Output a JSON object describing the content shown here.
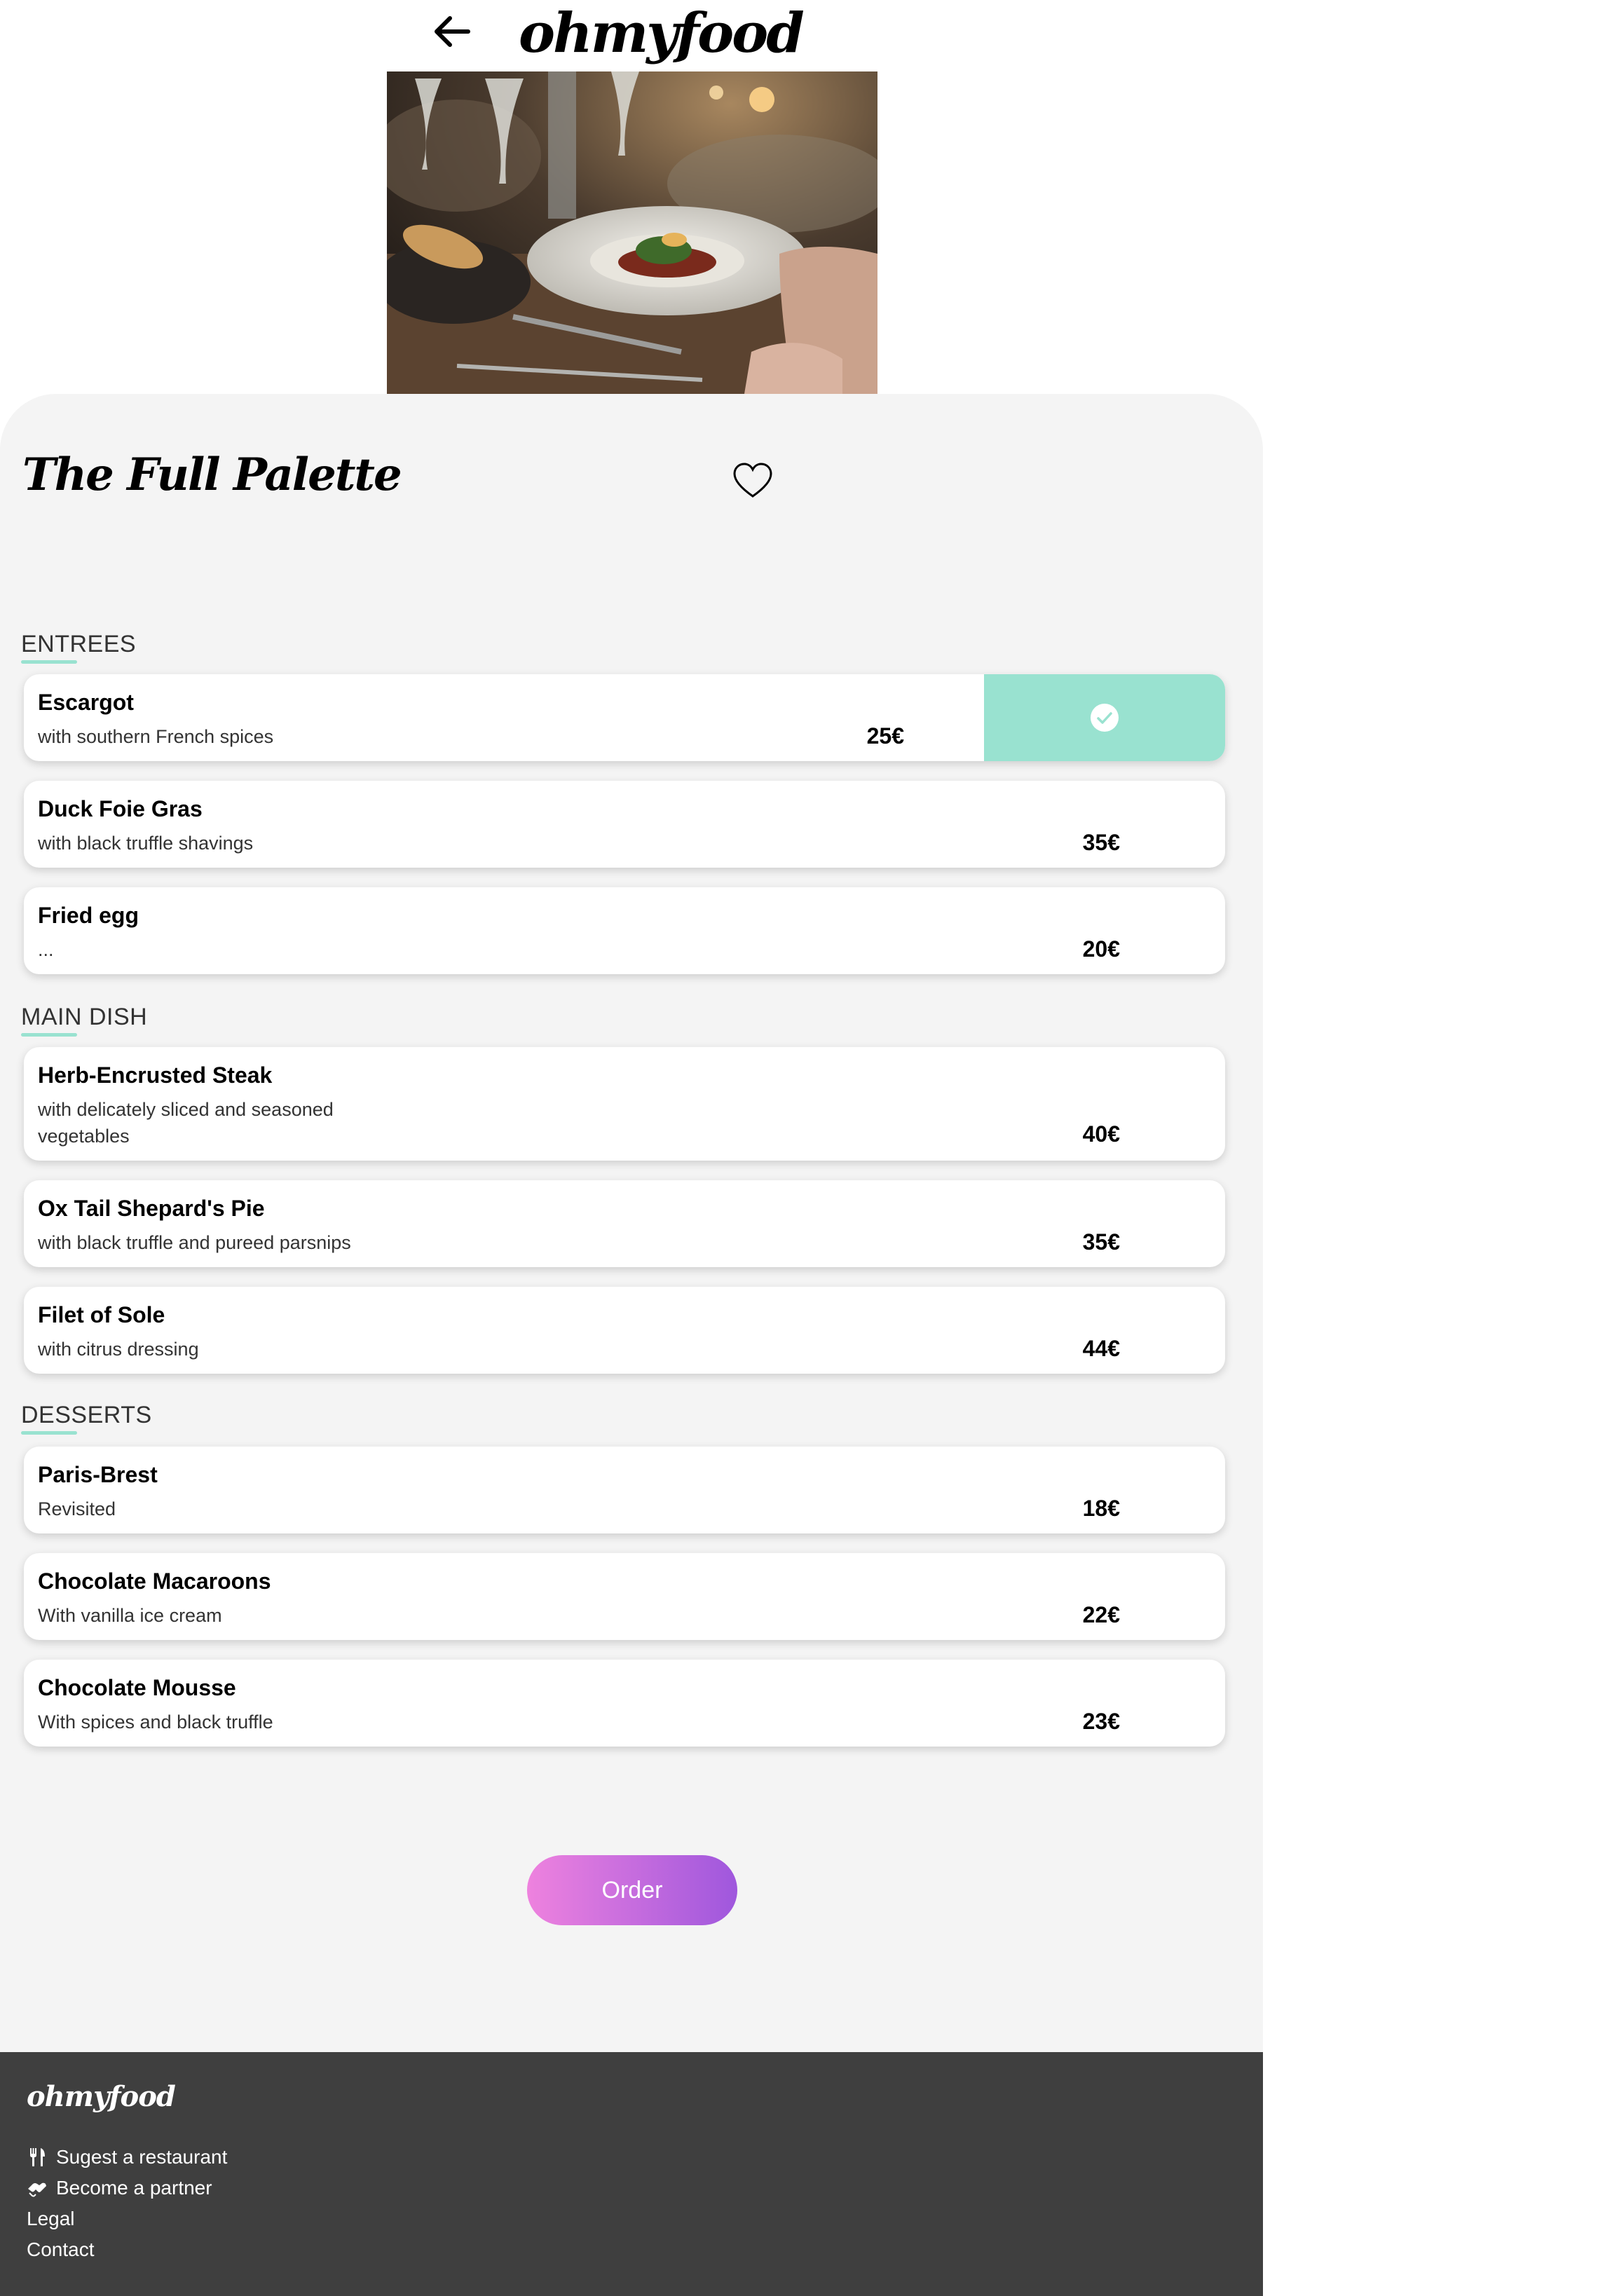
{
  "header": {
    "back_icon": "arrow-left-icon",
    "logo": "ohmyfood"
  },
  "hero": {
    "alt": "Restaurant table with a plated dish"
  },
  "restaurant": {
    "name": "The Full Palette",
    "favorite_icon": "heart-outline-icon"
  },
  "sections": [
    {
      "title": "ENTREES",
      "items": [
        {
          "name": "Escargot",
          "description": "with southern French spices",
          "price": "25€",
          "selected": true
        },
        {
          "name": "Duck Foie Gras",
          "description": "with black truffle shavings",
          "price": "35€",
          "selected": false
        },
        {
          "name": "Fried egg",
          "description": "...",
          "price": "20€",
          "selected": false
        }
      ]
    },
    {
      "title": "MAIN DISH",
      "items": [
        {
          "name": "Herb-Encrusted Steak",
          "description": "with delicately sliced and seasoned vegetables",
          "price": "40€",
          "selected": false
        },
        {
          "name": "Ox Tail Shepard's Pie",
          "description": "with black truffle and pureed parsnips",
          "price": "35€",
          "selected": false
        },
        {
          "name": "Filet of Sole",
          "description": "with citrus dressing",
          "price": "44€",
          "selected": false
        }
      ]
    },
    {
      "title": "DESSERTS",
      "items": [
        {
          "name": "Paris-Brest",
          "description": "Revisited",
          "price": "18€",
          "selected": false
        },
        {
          "name": "Chocolate Macaroons",
          "description": "With vanilla ice cream",
          "price": "22€",
          "selected": false
        },
        {
          "name": "Chocolate Mousse",
          "description": "With spices and black truffle",
          "price": "23€",
          "selected": false
        }
      ]
    }
  ],
  "order_button": "Order",
  "footer": {
    "logo": "ohmyfood",
    "links": [
      {
        "label": "Sugest a restaurant",
        "icon": "utensils-icon"
      },
      {
        "label": "Become a partner",
        "icon": "handshake-icon"
      },
      {
        "label": "Legal",
        "icon": ""
      },
      {
        "label": "Contact",
        "icon": ""
      }
    ]
  },
  "colors": {
    "accent": "#99e2d0",
    "order_gradient_start": "#ee82de",
    "order_gradient_end": "#9f57dd",
    "footer_bg": "#3f3f3f",
    "main_bg": "#f4f4f4"
  }
}
